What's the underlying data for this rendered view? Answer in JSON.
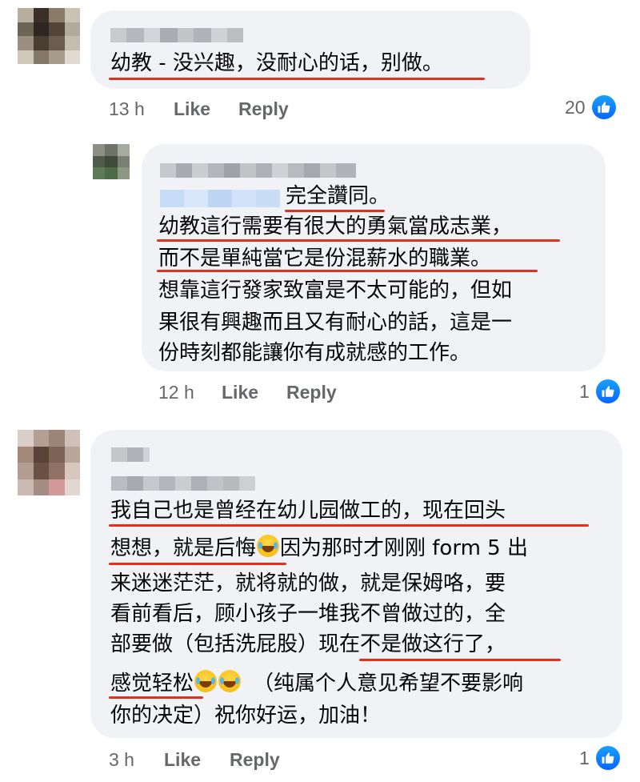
{
  "comments": [
    {
      "lines": [
        "幼教 - 没兴趣，没耐心的话，别做。"
      ],
      "time": "13 h",
      "like_label": "Like",
      "reply_label": "Reply",
      "reactions": "20"
    },
    {
      "lines": [
        "完全讚同。",
        "幼教這行需要有很大的勇氣當成志業，",
        "而不是單純當它是份混薪水的職業。",
        "想靠這行發家致富是不太可能的，但如",
        "果很有興趣而且又有耐心的話，這是一",
        "份時刻都能讓你有成就感的工作。"
      ],
      "time": "12 h",
      "like_label": "Like",
      "reply_label": "Reply",
      "reactions": "1"
    },
    {
      "lines": [
        "我自己也是曾经在幼儿园做工的，现在回头",
        "想想，就是后悔",
        "因为那时才刚刚 form 5 出",
        "来迷迷茫茫，就将就的做，就是保姆咯，要",
        "看前看后，顾小孩子一堆我不曾做过的，全",
        "部要做（包括洗屁股）现在不是做这行了，",
        "感觉轻松",
        "（纯属个人意见希望不要影响",
        "你的决定）祝你好运，加油！"
      ],
      "time": "3 h",
      "like_label": "Like",
      "reply_label": "Reply",
      "reactions": "1"
    }
  ],
  "colors": {
    "bubble": "#f0f2f5",
    "text": "#050505",
    "meta": "#65676b",
    "underline": "#e0301e",
    "like_blue": "#0866ff"
  },
  "icons": {
    "reaction": "like-thumbs-up-icon",
    "emoji": "laughing-tears-emoji"
  }
}
